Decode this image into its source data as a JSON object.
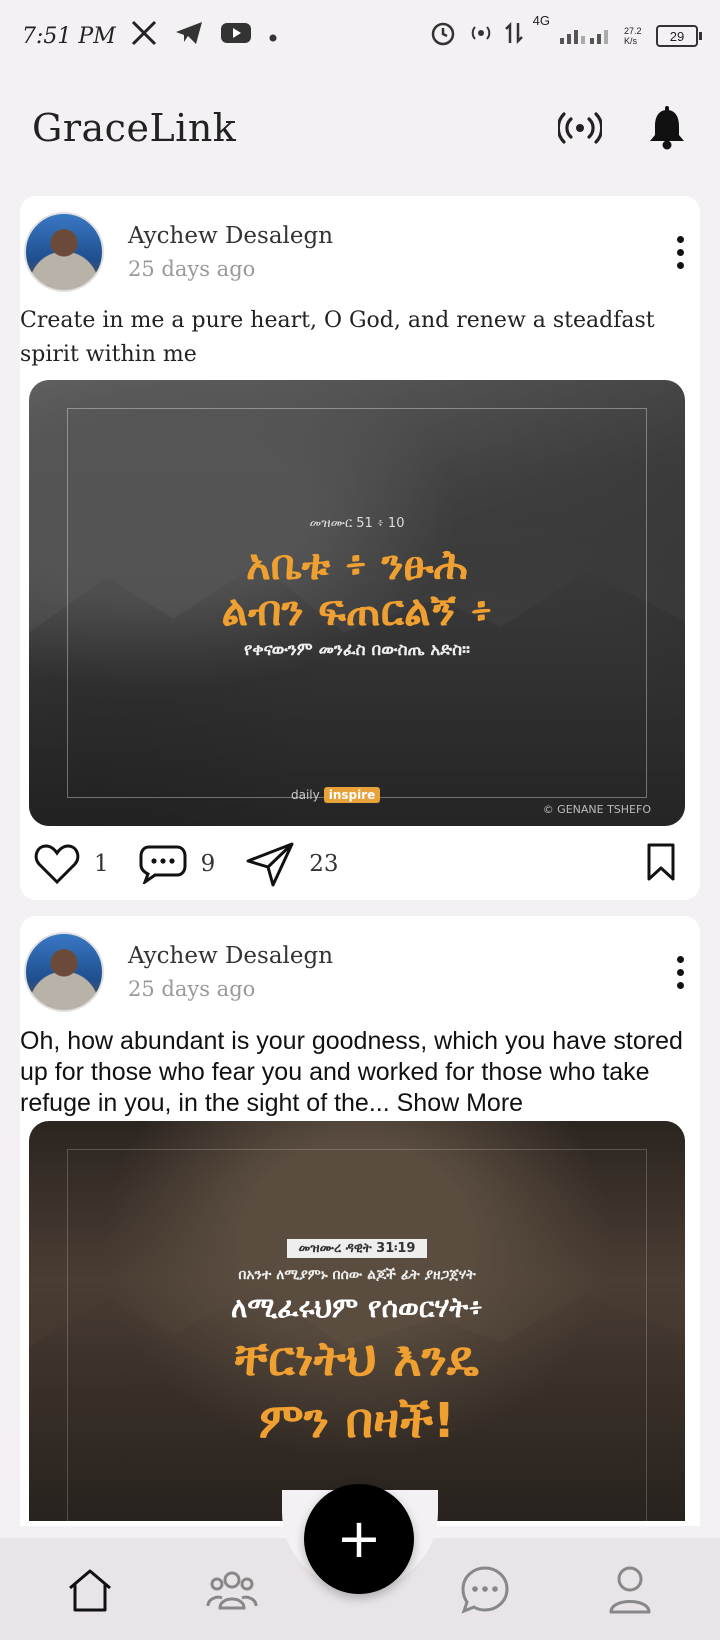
{
  "status_bar": {
    "time": "7:51 PM",
    "network": "4G",
    "speed": "27.2 K/s",
    "battery": "29"
  },
  "header": {
    "title": "GraceLink"
  },
  "posts": [
    {
      "author": "Aychew Desalegn",
      "time_ago": "25 days ago",
      "text": "Create in me a pure heart, O God, and renew a steadfast spirit within me",
      "image": {
        "ref": "መዝሙር 51 ፥ 10",
        "line1": "አቤቱ ፥ ንፁሕ",
        "line2": "ልብን ፍጠርልኝ ፥",
        "line3": "የቀናውንም መንፈስ በውስጤ አድስ።",
        "brand": "daily",
        "brand_badge": "inspire",
        "credit": "© GENANE TSHEFO"
      },
      "likes": "1",
      "comments": "9",
      "shares": "23"
    },
    {
      "author": "Aychew Desalegn",
      "time_ago": "25 days ago",
      "text": "Oh, how abundant is your goodness, which you have stored up for those who fear you and worked for those who take refuge in you, in the sight of the... Show More",
      "image": {
        "ref": "መዝሙረ ዳዊት 31፡19",
        "line0": "በአንተ ለሚያምኑ በሰው ልጆች ፊት ያዘጋጀሃት",
        "line1": "ለሚፈሩህም የሰወርሃት፥",
        "line2": "ቸርነትህ እንዴ",
        "line3": "ምን በዛች!"
      }
    }
  ],
  "colors": {
    "accent_orange": "#f0a030",
    "fab": "#000000"
  },
  "icons": {
    "header": [
      "broadcast-icon",
      "bell-icon"
    ],
    "nav": [
      "home-icon",
      "groups-icon",
      "add-icon",
      "chat-icon",
      "profile-icon"
    ]
  }
}
